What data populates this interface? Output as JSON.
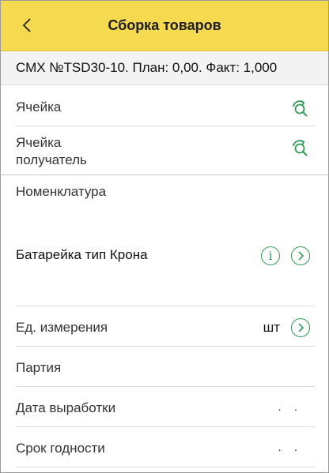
{
  "header": {
    "title": "Сборка товаров"
  },
  "info_bar": {
    "text": "СМХ №TSD30-10. План: 0,00. Факт: 1,000"
  },
  "fields": {
    "cell": {
      "label": "Ячейка"
    },
    "recipient_cell": {
      "label_line1": "Ячейка",
      "label_line2": "получатель"
    },
    "nomenclature": {
      "label": "Номенклатура",
      "value": "Батарейка тип Крона"
    },
    "unit": {
      "label": "Ед. измерения",
      "value": "шт"
    },
    "batch": {
      "label": "Партия"
    },
    "production_date": {
      "label": "Дата выработки",
      "value": ". ."
    },
    "expiry_date": {
      "label": "Срок годности",
      "value": ". ."
    }
  },
  "colors": {
    "header_bg": "#f5d94f",
    "accent": "#2e9b55"
  }
}
